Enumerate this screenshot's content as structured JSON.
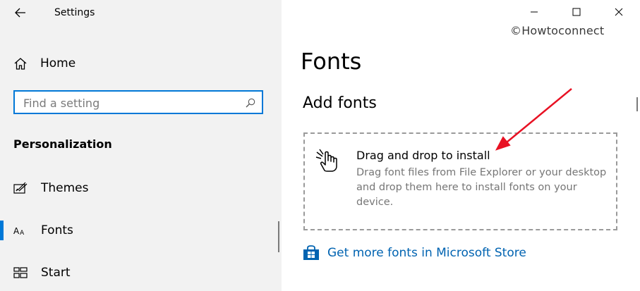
{
  "window": {
    "title": "Settings",
    "watermark": "©Howtoconnect"
  },
  "sidebar": {
    "home_label": "Home",
    "search_placeholder": "Find a setting",
    "section_title": "Personalization",
    "items": [
      {
        "label": "Themes",
        "icon": "themes-icon",
        "selected": false
      },
      {
        "label": "Fonts",
        "icon": "fonts-icon",
        "selected": true
      },
      {
        "label": "Start",
        "icon": "start-icon",
        "selected": false
      }
    ]
  },
  "main": {
    "title": "Fonts",
    "subtitle": "Add fonts",
    "drop_zone": {
      "title": "Drag and drop to install",
      "description": "Drag font files from File Explorer or your desktop and drop them here to install fonts on your device."
    },
    "store_link": "Get more fonts in Microsoft Store"
  },
  "colors": {
    "accent": "#0078d7",
    "link": "#0063b1",
    "annotation_arrow": "#e81123",
    "sidebar_bg": "#f2f2f2"
  }
}
